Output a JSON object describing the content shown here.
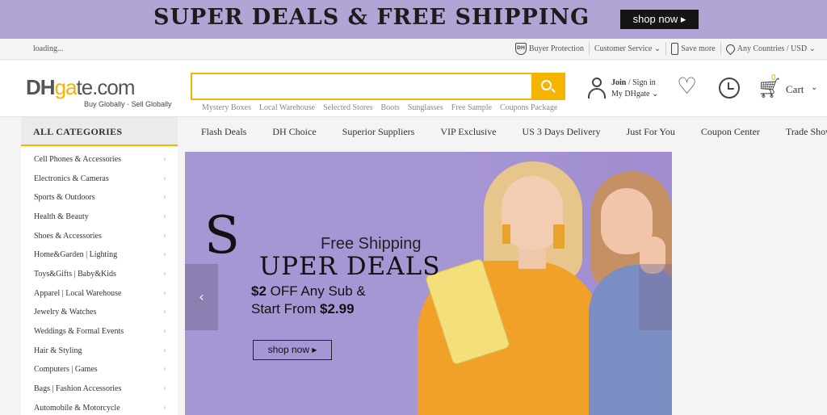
{
  "top_banner": {
    "title": "SUPER DEALS & FREE SHIPPING",
    "shop_now": "shop now ▸",
    "bg_color": "#b3a4d6"
  },
  "utility_bar": {
    "loading": "loading...",
    "buyer_protection": "Buyer Protection",
    "customer_service": "Customer Service ⌄",
    "save_more": "Save more",
    "region": "Any Countries / USD ⌄"
  },
  "header": {
    "logo_dh": "DH",
    "logo_ga": "ga",
    "logo_te": "te.com",
    "logo_sub": "Buy Globally · Sell Globally",
    "search_placeholder": "",
    "hot_searches": [
      "Mystery Boxes",
      "Local Warehouse",
      "Selected Stores",
      "Boots",
      "Sunglasses",
      "Free Sample",
      "Coupons Package"
    ],
    "account_join": "Join",
    "account_signin": " / Sign in",
    "account_my": "My DHgate ⌄",
    "cart_count": "0",
    "cart_label": "Cart",
    "accent_color": "#f5b400"
  },
  "nav": {
    "all_categories": "ALL CATEGORIES",
    "items": [
      "Flash Deals",
      "DH Choice",
      "Superior Suppliers",
      "VIP Exclusive",
      "US 3 Days Delivery",
      "Just For You",
      "Coupon Center",
      "Trade Show"
    ]
  },
  "categories": [
    "Cell Phones & Accessories",
    "Electronics & Cameras",
    "Sports & Outdoors",
    "Health & Beauty",
    "Shoes & Accessories",
    "Home&Garden | Lighting",
    "Toys&Gifts | Baby&Kids",
    "Apparel | Local Warehouse",
    "Jewelry & Watches",
    "Weddings & Formal Events",
    "Hair & Styling",
    "Computers | Games",
    "Bags | Fashion Accessories",
    "Automobile & Motorcycle"
  ],
  "hero": {
    "big_s": "S",
    "free_shipping": "Free Shipping",
    "super_deals": "UPER DEALS",
    "off_prefix": "$2",
    "off_rest": " OFF Any Sub &",
    "from_prefix": "Start From ",
    "from_price": "$2.99",
    "shop_now": "shop now ▸",
    "prev": "‹",
    "bg_color": "#a796d4"
  }
}
